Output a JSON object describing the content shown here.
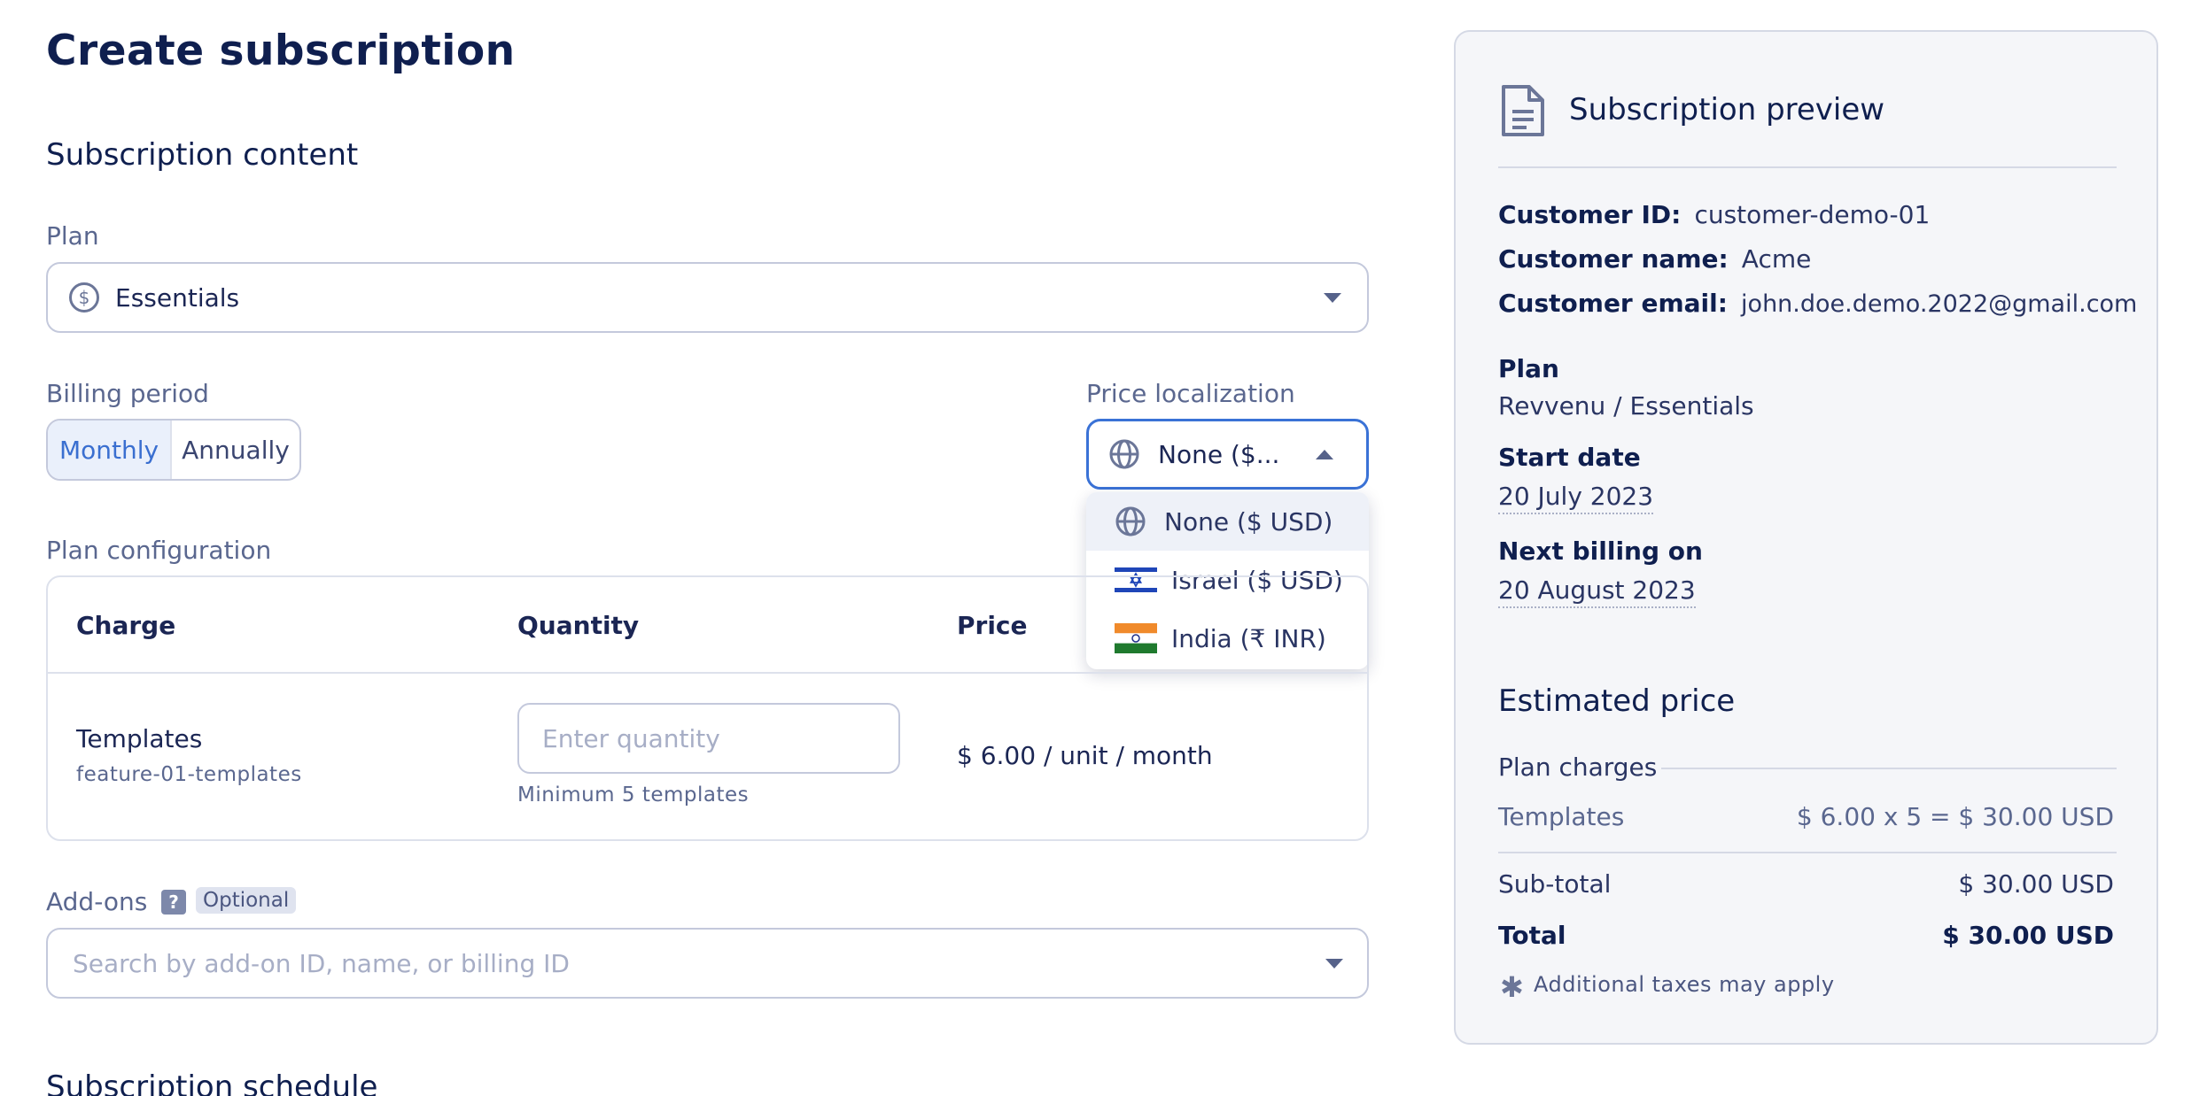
{
  "page": {
    "title": "Create subscription"
  },
  "content": {
    "section_title": "Subscription content",
    "plan_label": "Plan",
    "plan_value": "Essentials",
    "billing_label": "Billing period",
    "billing_options": [
      "Monthly",
      "Annually"
    ],
    "billing_selected": "Monthly",
    "price_loc_label": "Price localization",
    "price_loc_value": "None ($...",
    "price_loc_options": [
      {
        "label": "None ($ USD)",
        "icon": "globe-icon"
      },
      {
        "label": "Israel ($ USD)",
        "icon": "israel-flag-icon"
      },
      {
        "label": "India (₹ INR)",
        "icon": "india-flag-icon"
      }
    ],
    "config_label": "Plan configuration",
    "table_headers": [
      "Charge",
      "Quantity",
      "Price"
    ],
    "charge_name": "Templates",
    "charge_id": "feature-01-templates",
    "qty_placeholder": "Enter quantity",
    "qty_hint": "Minimum 5 templates",
    "price_text": "$ 6.00 / unit / month",
    "addons_label": "Add-ons",
    "addons_help": "?",
    "addons_badge": "Optional",
    "addons_placeholder": "Search by add-on ID, name, or billing ID",
    "schedule_title": "Subscription schedule"
  },
  "preview": {
    "title": "Subscription preview",
    "customer_id_label": "Customer ID:",
    "customer_id": "customer-demo-01",
    "customer_name_label": "Customer name:",
    "customer_name": "Acme",
    "customer_email_label": "Customer email:",
    "customer_email": "john.doe.demo.2022@gmail.com",
    "plan_label": "Plan",
    "plan_value": "Revvenu / Essentials",
    "start_label": "Start date",
    "start_value": "20 July 2023",
    "next_label": "Next billing on",
    "next_value": "20 August 2023",
    "estimated_title": "Estimated price",
    "plan_charges_label": "Plan charges",
    "line_item_name": "Templates",
    "line_item_value": "$ 6.00 x 5 = $ 30.00 USD",
    "subtotal_label": "Sub-total",
    "subtotal_value": "$ 30.00 USD",
    "total_label": "Total",
    "total_value": "$ 30.00 USD",
    "tax_note": "Additional taxes may apply"
  },
  "colors": {
    "accent": "#3a72d6",
    "primary_text": "#0f1f4f",
    "muted_text": "#5a678f"
  }
}
